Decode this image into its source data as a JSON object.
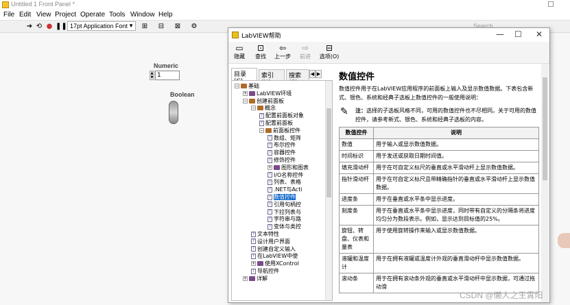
{
  "app": {
    "title": "Untitled 1 Front Panel *",
    "menu": [
      "File",
      "Edit",
      "View",
      "Project",
      "Operate",
      "Tools",
      "Window",
      "Help"
    ],
    "font_dropdown": "17pt Application Font",
    "search_placeholder": "Search"
  },
  "front_panel": {
    "numeric_label": "Numeric",
    "numeric_value": "1",
    "boolean_label": "Boolean"
  },
  "help": {
    "title": "LabVIEW帮助",
    "toolbar": [
      {
        "label": "隐藏",
        "icon": "hide-icon",
        "glyph": "▭"
      },
      {
        "label": "查找",
        "icon": "locate-icon",
        "glyph": "⊡"
      },
      {
        "label": "上一步",
        "icon": "back-icon",
        "glyph": "⇦"
      },
      {
        "label": "前进",
        "icon": "forward-icon",
        "glyph": "⇨"
      },
      {
        "label": "选项(O)",
        "icon": "options-icon",
        "glyph": "⊟"
      }
    ],
    "tabs": [
      "目录(C)",
      "索引(N)",
      "搜索(S)"
    ],
    "tree": [
      {
        "label": "基础",
        "level": 0,
        "kind": "book-open",
        "exp": "−"
      },
      {
        "label": "LabVIEW环境",
        "level": 1,
        "kind": "book",
        "exp": "+"
      },
      {
        "label": "创建前面板",
        "level": 1,
        "kind": "book-open",
        "exp": "−"
      },
      {
        "label": "概念",
        "level": 2,
        "kind": "book-open",
        "exp": "−"
      },
      {
        "label": "配置前面板对象",
        "level": 3,
        "kind": "page"
      },
      {
        "label": "配置前面板",
        "level": 3,
        "kind": "page"
      },
      {
        "label": "前面板控件",
        "level": 3,
        "kind": "book-open",
        "exp": "−"
      },
      {
        "label": "数组、矩阵",
        "level": 4,
        "kind": "page"
      },
      {
        "label": "布尔控件",
        "level": 4,
        "kind": "page"
      },
      {
        "label": "容器控件",
        "level": 4,
        "kind": "page"
      },
      {
        "label": "修饰控件",
        "level": 4,
        "kind": "page"
      },
      {
        "label": "图形和图表",
        "level": 4,
        "kind": "book",
        "exp": "+"
      },
      {
        "label": "I/O名称控件",
        "level": 4,
        "kind": "page"
      },
      {
        "label": "列表、表格",
        "level": 4,
        "kind": "page"
      },
      {
        "label": ".NET与Acti",
        "level": 4,
        "kind": "page"
      },
      {
        "label": "数值控件",
        "level": 4,
        "kind": "page",
        "selected": true
      },
      {
        "label": "引用句柄控",
        "level": 4,
        "kind": "page"
      },
      {
        "label": "下拉列表与",
        "level": 4,
        "kind": "page"
      },
      {
        "label": "字符串与路",
        "level": 4,
        "kind": "page"
      },
      {
        "label": "变体与类控",
        "level": 4,
        "kind": "page"
      },
      {
        "label": "文本特性",
        "level": 2,
        "kind": "page"
      },
      {
        "label": "设计用户界面",
        "level": 2,
        "kind": "page"
      },
      {
        "label": "创建自定义输入",
        "level": 2,
        "kind": "page"
      },
      {
        "label": "在LabVIEW中使",
        "level": 2,
        "kind": "page"
      },
      {
        "label": "使用XControl",
        "level": 2,
        "kind": "book",
        "exp": "+"
      },
      {
        "label": "导航控件",
        "level": 2,
        "kind": "page"
      },
      {
        "label": "详解",
        "level": 1,
        "kind": "book",
        "exp": "+"
      }
    ],
    "content": {
      "title": "数值控件",
      "intro": "数值控件用于在LabVIEW应用程序的前面板上输入及显示数值数据。下表包含新式、银色、系统和经典子选板上数值控件的一般使用说明：",
      "note_label": "注：",
      "note_text": "选择的子选板风格不同，可用的数值控件也不尽相同。关于可用的数值控件，请参考新式、银色、系统和经典子选板的内容。",
      "table_headers": [
        "数值控件",
        "说明"
      ],
      "table_rows": [
        [
          "数值",
          "用于输入或显示数值数据。"
        ],
        [
          "时间标识",
          "用于发送或获取日期时间值。"
        ],
        [
          "填充滑动杆",
          "用于在可自定义标尺的垂直或水平滑动杆上显示数值数据。"
        ],
        [
          "指针滑动杆",
          "用于在可自定义标尺且带精确指针的垂直或水平滑动杆上显示数值数据。"
        ],
        [
          "进度条",
          "用于在垂直或水平条中显示进度。"
        ],
        [
          "刻度条",
          "用于在垂直或水平条中显示进度，同时带有自定义的分隔条将进度均匀分为数段表示。例如，显示达到目标值的25%。"
        ],
        [
          "旋钮、转盘、仪表和量表",
          "用于使用旋转操作来输入或显示数值数据。"
        ],
        [
          "液罐和温度计",
          "用于在拥有液罐或温度计外观的垂直滑动杆中显示数值数据。"
        ],
        [
          "滚动条",
          "用于在拥有滚动条外观的垂直或水平滑动杆中显示数据，可通过拖动滑"
        ]
      ]
    }
  },
  "watermark": "CSDN @懒人之王霄阳"
}
